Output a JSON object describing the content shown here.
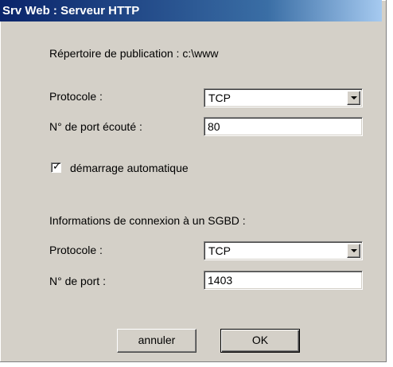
{
  "window": {
    "title": "Srv Web : Serveur HTTP"
  },
  "publication": {
    "label": "Répertoire de publication : c:\\www"
  },
  "http": {
    "protocol_label": "Protocole :",
    "protocol_value": "TCP",
    "port_label": "N° de port écouté :",
    "port_value": "80"
  },
  "autostart": {
    "label": "démarrage automatique",
    "checked": true,
    "check_glyph": "✓"
  },
  "sgbd": {
    "section_label": "Informations de connexion à un SGBD :",
    "protocol_label": "Protocole :",
    "protocol_value": "TCP",
    "port_label": "N° de port  :",
    "port_value": "1403"
  },
  "buttons": {
    "cancel": "annuler",
    "ok": "OK"
  },
  "colors": {
    "dialog_bg": "#d4d0c8",
    "titlebar": "#0a246a"
  }
}
